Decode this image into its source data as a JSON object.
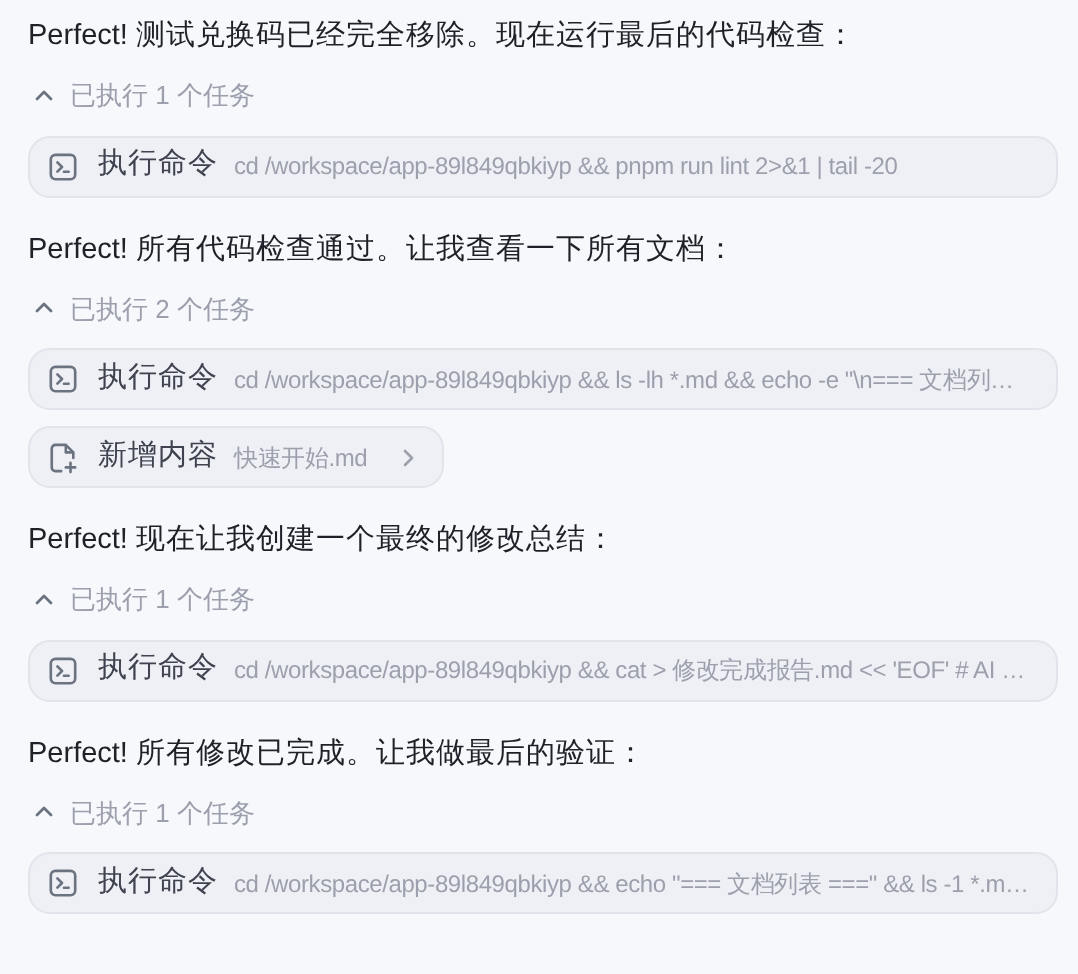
{
  "messages": [
    {
      "text": "Perfect! 测试兑换码已经完全移除。现在运行最后的代码检查：",
      "tasks": {
        "summary": "已执行 1 个任务",
        "expanded": true,
        "items": [
          {
            "kind": "command",
            "label": "执行命令",
            "detail": "cd /workspace/app-89l849qbkiyp && pnpm run lint 2>&1 | tail -20"
          }
        ]
      }
    },
    {
      "text": "Perfect! 所有代码检查通过。让我查看一下所有文档：",
      "tasks": {
        "summary": "已执行 2 个任务",
        "expanded": true,
        "items": [
          {
            "kind": "command",
            "label": "执行命令",
            "detail": "cd /workspace/app-89l849qbkiyp && ls -lh *.md && echo -e \"\\n=== 文档列…"
          },
          {
            "kind": "file",
            "label": "新增内容",
            "detail": "快速开始.md"
          }
        ]
      }
    },
    {
      "text": "Perfect! 现在让我创建一个最终的修改总结：",
      "tasks": {
        "summary": "已执行 1 个任务",
        "expanded": true,
        "items": [
          {
            "kind": "command",
            "label": "执行命令",
            "detail": "cd /workspace/app-89l849qbkiyp && cat > 修改完成报告.md << 'EOF' # AI …"
          }
        ]
      }
    },
    {
      "text": "Perfect! 所有修改已完成。让我做最后的验证：",
      "tasks": {
        "summary": "已执行 1 个任务",
        "expanded": true,
        "items": [
          {
            "kind": "command",
            "label": "执行命令",
            "detail": "cd /workspace/app-89l849qbkiyp && echo \"=== 文档列表 ===\" && ls -1 *.m…"
          }
        ]
      }
    }
  ]
}
